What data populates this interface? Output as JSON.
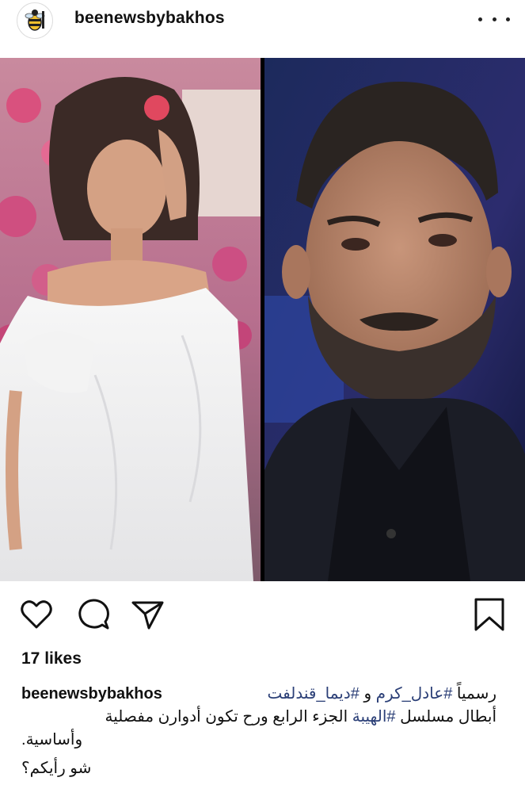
{
  "post": {
    "username": "beenewsbybakhos",
    "likes_text": "17 likes"
  },
  "caption": {
    "username": "beenewsbybakhos",
    "line1_prefix": "رسمياً",
    "tag1": "#عادل_كرم",
    "line1_mid": "و",
    "tag2": "#ديما_قندلفت",
    "line2_prefix": "أبطال مسلسل",
    "tag3": "#الهيبة",
    "line2_suffix": "الجزء الرابع  ورح تكون أدوارن مفصلية",
    "line3": ".وأساسية",
    "line4": "شو رأيكم؟"
  },
  "icons": {
    "avatar": "bee-logo-avatar",
    "more": "more-options-icon",
    "like": "heart-icon",
    "comment": "comment-icon",
    "share": "send-icon",
    "save": "bookmark-icon"
  },
  "colors": {
    "hashtag": "#2b3f77",
    "text": "#111111"
  }
}
